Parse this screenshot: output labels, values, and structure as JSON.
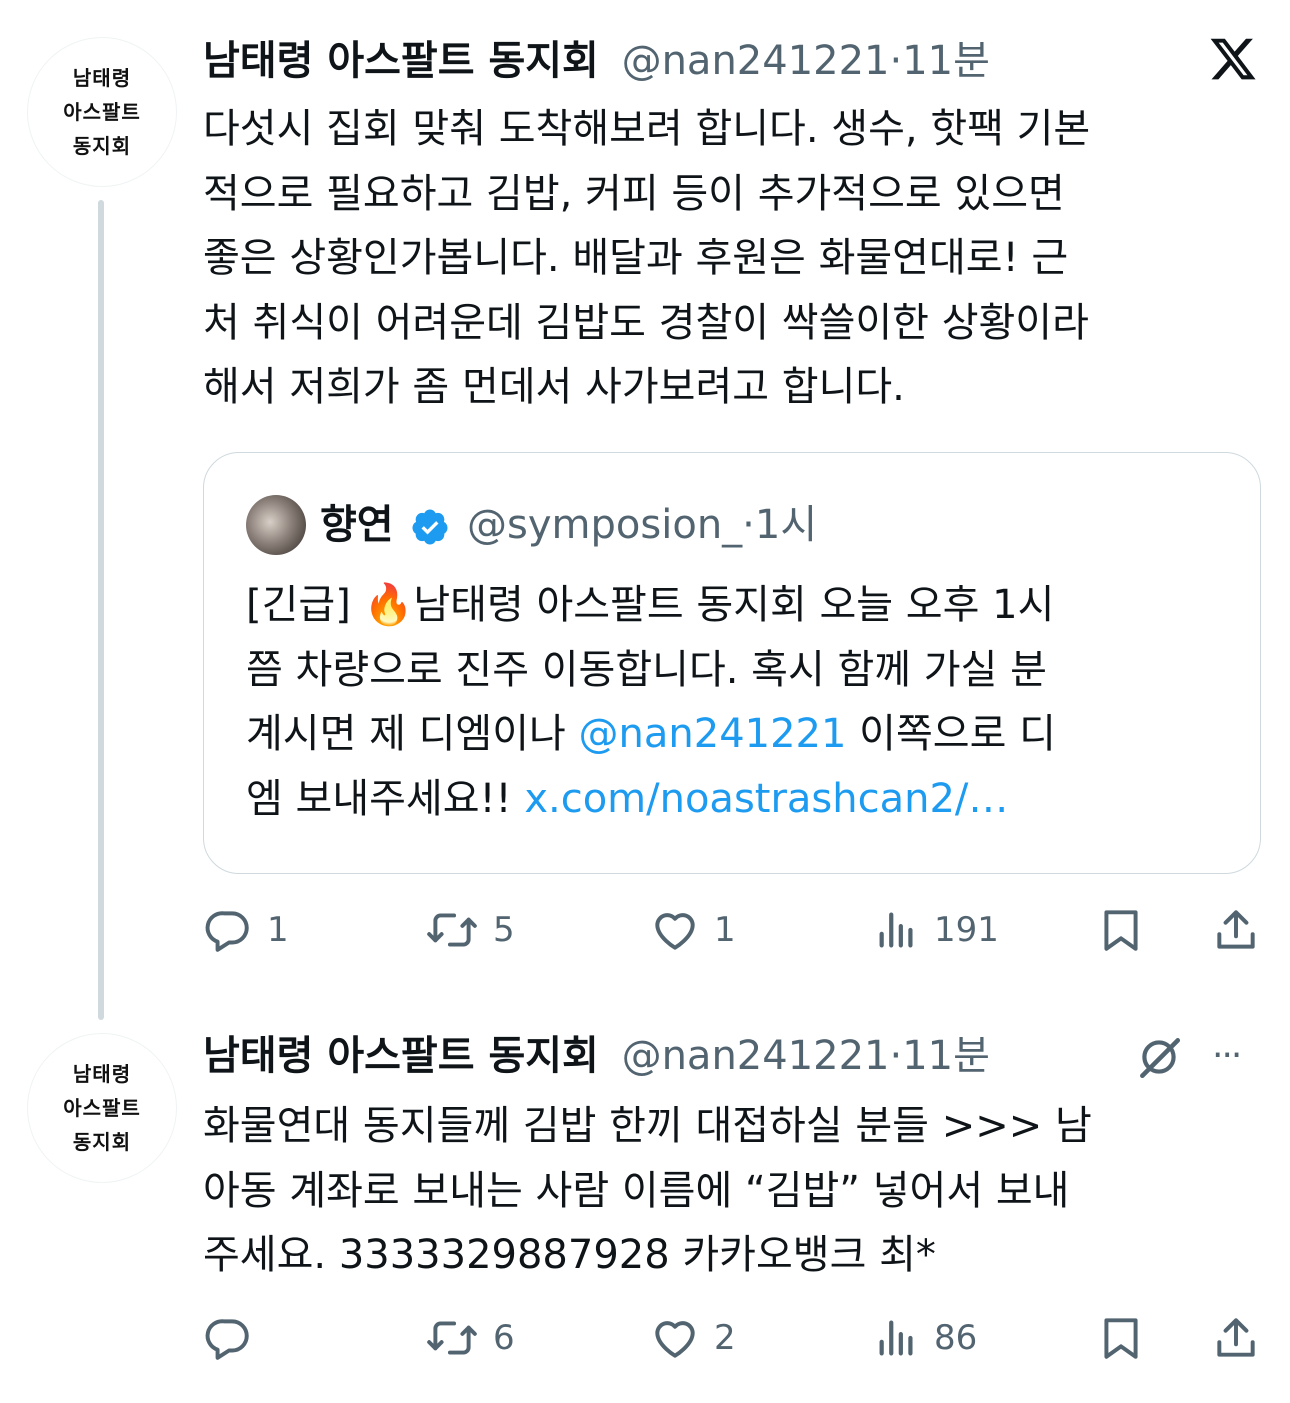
{
  "tweet1": {
    "avatar_lines": [
      "남태령",
      "아스팔트",
      "동지회"
    ],
    "display_name": "남태령 아스팔트 동지회",
    "handle": "@nan241221",
    "dot": "·",
    "time": "11분",
    "text_lines": [
      "다섯시 집회 맞춰 도착해보려 합니다. 생수, 핫팩 기본",
      "적으로 필요하고 김밥, 커피 등이 추가적으로 있으면",
      "좋은 상황인가봅니다. 배달과 후원은 화물연대로! 근",
      "처 취식이 어려운데 김밥도 경찰이 싹쓸이한 상황이라",
      "해서 저희가 좀 먼데서 사가보려고 합니다."
    ],
    "quote": {
      "display_name": "향연",
      "handle": "@symposion_",
      "dot": "·",
      "time": "1시",
      "line1_prefix": "[긴급] ",
      "line1_emoji": "🔥",
      "line1_rest": "남태령 아스팔트 동지회 오늘 오후 1시",
      "line2": "쯤 차량으로 진주 이동합니다. 혹시 함께 가실 분",
      "line3_prefix": "계시면 제 디엠이나 ",
      "line3_mention": "@nan241221",
      "line3_suffix": " 이쪽으로 디",
      "line4_prefix": "엠 보내주세요!! ",
      "line4_link": "x.com/noastrashcan2/…"
    },
    "actions": {
      "replies": "1",
      "retweets": "5",
      "likes": "1",
      "views": "191"
    }
  },
  "tweet2": {
    "avatar_lines": [
      "남태령",
      "아스팔트",
      "동지회"
    ],
    "display_name": "남태령 아스팔트 동지회",
    "handle": "@nan241221",
    "dot": "·",
    "time": "11분",
    "more": "···",
    "text_lines": [
      "화물연대 동지들께 김밥 한끼 대접하실 분들 >>> 남",
      "아동 계좌로 보내는 사람 이름에 “김밥” 넣어서 보내",
      "주세요. 3333329887928 카카오뱅크 최*"
    ],
    "actions": {
      "replies": "",
      "retweets": "6",
      "likes": "2",
      "views": "86"
    }
  },
  "icons": [
    "x-logo-icon",
    "reply-icon",
    "retweet-icon",
    "like-icon",
    "views-icon",
    "bookmark-icon",
    "share-icon",
    "grok-icon",
    "more-icon",
    "verified-icon"
  ],
  "colors": {
    "text": "#0f1419",
    "secondary": "#536471",
    "link": "#1d9bf0",
    "border": "#cfd9de"
  }
}
